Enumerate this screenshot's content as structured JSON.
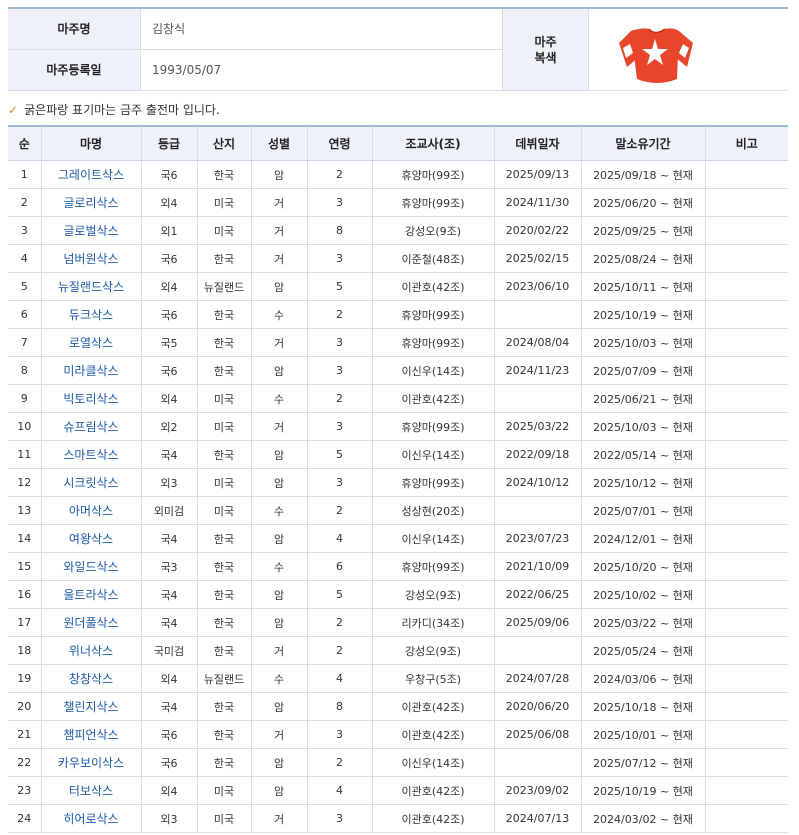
{
  "owner": {
    "name_label": "마주명",
    "name": "김창식",
    "reg_label": "마주등록일",
    "reg_date": "1993/05/07",
    "silks_label_1": "마주",
    "silks_label_2": "복색",
    "silks_colors": {
      "body": "#e8462a",
      "sleeves": "#e8462a",
      "sleeve_band": "#ffffff",
      "star": "#ffffff"
    }
  },
  "notice": {
    "icon": "check-icon",
    "text": "굵은파랑 표기마는 금주 출전마 입니다."
  },
  "table": {
    "headers": [
      "순",
      "마명",
      "등급",
      "산지",
      "성별",
      "연령",
      "조교사(조)",
      "데뷔일자",
      "말소유기간",
      "비고"
    ],
    "rows": [
      [
        "1",
        "그레이트삭스",
        "국6",
        "한국",
        "암",
        "2",
        "휴양마(99조)",
        "2025/09/13",
        "2025/09/18 ~ 현재",
        ""
      ],
      [
        "2",
        "글로리삭스",
        "외4",
        "미국",
        "거",
        "3",
        "휴양마(99조)",
        "2024/11/30",
        "2025/06/20 ~ 현재",
        ""
      ],
      [
        "3",
        "글로벌삭스",
        "외1",
        "미국",
        "거",
        "8",
        "강성오(9조)",
        "2020/02/22",
        "2025/09/25 ~ 현재",
        ""
      ],
      [
        "4",
        "넘버원삭스",
        "국6",
        "한국",
        "거",
        "3",
        "이준철(48조)",
        "2025/02/15",
        "2025/08/24 ~ 현재",
        ""
      ],
      [
        "5",
        "뉴질랜드삭스",
        "외4",
        "뉴질랜드",
        "암",
        "5",
        "이관호(42조)",
        "2023/06/10",
        "2025/10/11 ~ 현재",
        ""
      ],
      [
        "6",
        "듀크삭스",
        "국6",
        "한국",
        "수",
        "2",
        "휴양마(99조)",
        "",
        "2025/10/19 ~ 현재",
        ""
      ],
      [
        "7",
        "로열삭스",
        "국5",
        "한국",
        "거",
        "3",
        "휴양마(99조)",
        "2024/08/04",
        "2025/10/03 ~ 현재",
        ""
      ],
      [
        "8",
        "미라클삭스",
        "국6",
        "한국",
        "암",
        "3",
        "이신우(14조)",
        "2024/11/23",
        "2025/07/09 ~ 현재",
        ""
      ],
      [
        "9",
        "빅토리삭스",
        "외4",
        "미국",
        "수",
        "2",
        "이관호(42조)",
        "",
        "2025/06/21 ~ 현재",
        ""
      ],
      [
        "10",
        "슈프림삭스",
        "외2",
        "미국",
        "거",
        "3",
        "휴양마(99조)",
        "2025/03/22",
        "2025/10/03 ~ 현재",
        ""
      ],
      [
        "11",
        "스마트삭스",
        "국4",
        "한국",
        "암",
        "5",
        "이신우(14조)",
        "2022/09/18",
        "2022/05/14 ~ 현재",
        ""
      ],
      [
        "12",
        "시크릿삭스",
        "외3",
        "미국",
        "암",
        "3",
        "휴양마(99조)",
        "2024/10/12",
        "2025/10/12 ~ 현재",
        ""
      ],
      [
        "13",
        "아머삭스",
        "외미검",
        "미국",
        "수",
        "2",
        "성상현(20조)",
        "",
        "2025/07/01 ~ 현재",
        ""
      ],
      [
        "14",
        "여왕삭스",
        "국4",
        "한국",
        "암",
        "4",
        "이신우(14조)",
        "2023/07/23",
        "2024/12/01 ~ 현재",
        ""
      ],
      [
        "15",
        "와일드삭스",
        "국3",
        "한국",
        "수",
        "6",
        "휴양마(99조)",
        "2021/10/09",
        "2025/10/20 ~ 현재",
        ""
      ],
      [
        "16",
        "울트라삭스",
        "국4",
        "한국",
        "암",
        "5",
        "강성오(9조)",
        "2022/06/25",
        "2025/10/02 ~ 현재",
        ""
      ],
      [
        "17",
        "원더풀삭스",
        "국4",
        "한국",
        "암",
        "2",
        "리카디(34조)",
        "2025/09/06",
        "2025/03/22 ~ 현재",
        ""
      ],
      [
        "18",
        "위너삭스",
        "국미검",
        "한국",
        "거",
        "2",
        "강성오(9조)",
        "",
        "2025/05/24 ~ 현재",
        ""
      ],
      [
        "19",
        "창창삭스",
        "외4",
        "뉴질랜드",
        "수",
        "4",
        "우창구(5조)",
        "2024/07/28",
        "2024/03/06 ~ 현재",
        ""
      ],
      [
        "20",
        "챌린지삭스",
        "국4",
        "한국",
        "암",
        "8",
        "이관호(42조)",
        "2020/06/20",
        "2025/10/18 ~ 현재",
        ""
      ],
      [
        "21",
        "챔피언삭스",
        "국6",
        "한국",
        "거",
        "3",
        "이관호(42조)",
        "2025/06/08",
        "2025/10/01 ~ 현재",
        ""
      ],
      [
        "22",
        "카우보이삭스",
        "국6",
        "한국",
        "암",
        "2",
        "이신우(14조)",
        "",
        "2025/07/12 ~ 현재",
        ""
      ],
      [
        "23",
        "터보삭스",
        "외4",
        "미국",
        "암",
        "4",
        "이관호(42조)",
        "2023/09/02",
        "2025/10/19 ~ 현재",
        ""
      ],
      [
        "24",
        "히어로삭스",
        "외3",
        "미국",
        "거",
        "3",
        "이관호(42조)",
        "2024/07/13",
        "2024/03/02 ~ 현재",
        ""
      ]
    ]
  }
}
